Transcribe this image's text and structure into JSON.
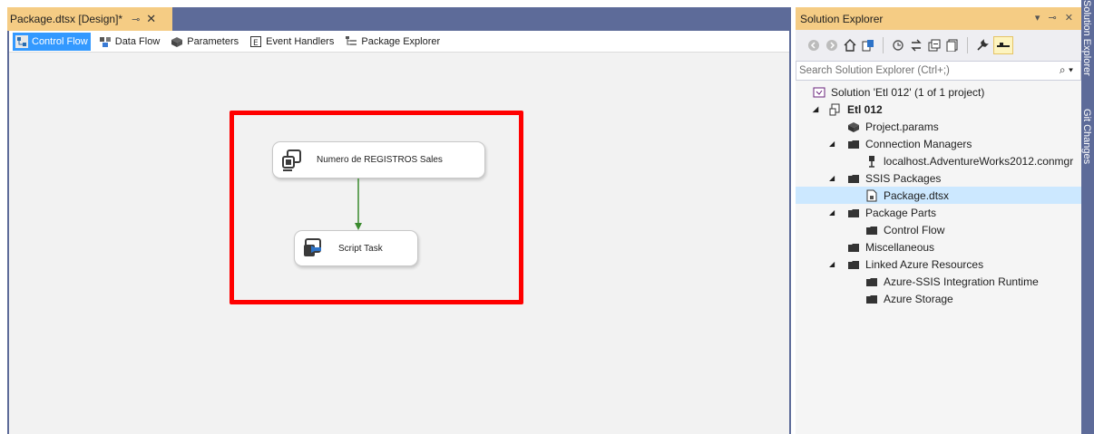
{
  "document_tab": {
    "title": "Package.dtsx [Design]*",
    "pin": "⊸",
    "close": "✕"
  },
  "designer_tabs": [
    {
      "label": "Control Flow",
      "active": true,
      "icon": "control-flow-icon"
    },
    {
      "label": "Data Flow",
      "active": false,
      "icon": "data-flow-icon"
    },
    {
      "label": "Parameters",
      "active": false,
      "icon": "parameters-icon"
    },
    {
      "label": "Event Handlers",
      "active": false,
      "icon": "event-handlers-icon"
    },
    {
      "label": "Package Explorer",
      "active": false,
      "icon": "package-explorer-icon"
    }
  ],
  "tasks": {
    "task1": {
      "label": "Numero de REGISTROS Sales",
      "icon": "execute-sql-task-icon"
    },
    "task2": {
      "label": "Script Task",
      "icon": "script-task-icon"
    }
  },
  "solution_explorer": {
    "title": "Solution Explorer",
    "title_controls": "▾ ⊸ ✕",
    "search_placeholder": "Search Solution Explorer (Ctrl+;)",
    "search_icon": "⌕ ▾",
    "tree": [
      {
        "label": "Solution 'Etl 012' (1 of 1 project)",
        "icon": "solution-icon"
      },
      {
        "label": "Etl 012",
        "icon": "project-icon",
        "bold": true
      },
      {
        "label": "Project.params",
        "icon": "params-icon"
      },
      {
        "label": "Connection Managers",
        "icon": "folder-icon"
      },
      {
        "label": "localhost.AdventureWorks2012.conmgr",
        "icon": "connection-icon"
      },
      {
        "label": "SSIS Packages",
        "icon": "folder-icon"
      },
      {
        "label": "Package.dtsx",
        "icon": "package-file-icon",
        "selected": true
      },
      {
        "label": "Package Parts",
        "icon": "folder-icon"
      },
      {
        "label": "Control Flow",
        "icon": "folder-icon"
      },
      {
        "label": "Miscellaneous",
        "icon": "folder-icon"
      },
      {
        "label": "Linked Azure Resources",
        "icon": "folder-icon"
      },
      {
        "label": "Azure-SSIS Integration Runtime",
        "icon": "folder-icon"
      },
      {
        "label": "Azure Storage",
        "icon": "folder-icon"
      }
    ]
  },
  "side_tabs": {
    "solution_explorer": "Solution Explorer",
    "git_changes": "Git Changes"
  },
  "colors": {
    "frame": "#5d6b99",
    "active_tab": "#f5cc84",
    "selection": "#cce8ff",
    "highlight": "#ff0000",
    "connector": "#3a8a2e"
  }
}
